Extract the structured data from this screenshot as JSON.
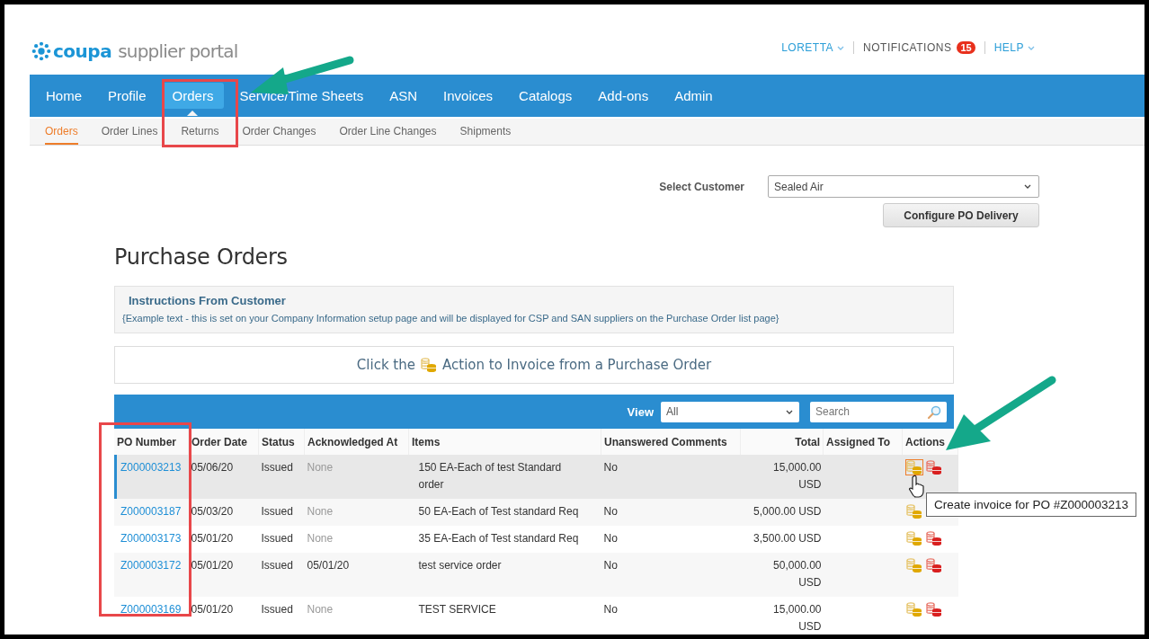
{
  "header": {
    "logo": {
      "brand": "coupa",
      "product": "supplier portal"
    },
    "user_menu": "LORETTA",
    "notifications": {
      "label": "NOTIFICATIONS",
      "count": "15"
    },
    "help": "HELP"
  },
  "nav": [
    {
      "label": "Home",
      "selected": false
    },
    {
      "label": "Profile",
      "selected": false
    },
    {
      "label": "Orders",
      "selected": true
    },
    {
      "label": "Service/Time Sheets",
      "selected": false
    },
    {
      "label": "ASN",
      "selected": false
    },
    {
      "label": "Invoices",
      "selected": false
    },
    {
      "label": "Catalogs",
      "selected": false
    },
    {
      "label": "Add-ons",
      "selected": false
    },
    {
      "label": "Admin",
      "selected": false
    }
  ],
  "subnav": [
    {
      "label": "Orders",
      "selected": true
    },
    {
      "label": "Order Lines",
      "selected": false
    },
    {
      "label": "Returns",
      "selected": false
    },
    {
      "label": "Order Changes",
      "selected": false
    },
    {
      "label": "Order Line Changes",
      "selected": false
    },
    {
      "label": "Shipments",
      "selected": false
    }
  ],
  "customer": {
    "label": "Select Customer",
    "value": "Sealed Air"
  },
  "configure_button": "Configure PO Delivery",
  "page_title": "Purchase Orders",
  "instructions": {
    "title": "Instructions From Customer",
    "text": "{Example text - this is set on your Company Information setup page and will be displayed for CSP and SAN suppliers on the Purchase Order list page}"
  },
  "invoice_hint": {
    "before": "Click the",
    "after": "Action to Invoice from a Purchase Order"
  },
  "table": {
    "view_label": "View",
    "view_value": "All",
    "search_placeholder": "Search",
    "columns": [
      "PO Number",
      "Order Date",
      "Status",
      "Acknowledged At",
      "Items",
      "Unanswered Comments",
      "Total",
      "Assigned To",
      "Actions"
    ],
    "rows": [
      {
        "po_number": "Z000003213",
        "order_date": "05/06/20",
        "status": "Issued",
        "acknowledged_at": "None",
        "acknowledged": false,
        "items": "150 EA-Each of test Standard order",
        "unanswered_comments": "No",
        "total": "15,000.00 USD",
        "selected": true,
        "actions": [
          {
            "kind": "invoice",
            "focused": true
          },
          {
            "kind": "flip",
            "focused": false
          }
        ]
      },
      {
        "po_number": "Z000003187",
        "order_date": "05/03/20",
        "status": "Issued",
        "acknowledged_at": "None",
        "acknowledged": false,
        "items": "50 EA-Each of Test standard Req",
        "unanswered_comments": "No",
        "total": "5,000.00 USD",
        "selected": false,
        "actions": [
          {
            "kind": "invoice",
            "focused": false
          }
        ]
      },
      {
        "po_number": "Z000003173",
        "order_date": "05/01/20",
        "status": "Issued",
        "acknowledged_at": "None",
        "acknowledged": false,
        "items": "35 EA-Each of Test standard Req",
        "unanswered_comments": "No",
        "total": "3,500.00 USD",
        "selected": false,
        "actions": [
          {
            "kind": "invoice",
            "focused": false
          },
          {
            "kind": "flip",
            "focused": false
          }
        ]
      },
      {
        "po_number": "Z000003172",
        "order_date": "05/01/20",
        "status": "Issued",
        "acknowledged_at": "05/01/20",
        "acknowledged": true,
        "items": "test service order",
        "unanswered_comments": "No",
        "total": "50,000.00 USD",
        "selected": false,
        "actions": [
          {
            "kind": "invoice",
            "focused": false
          },
          {
            "kind": "flip",
            "focused": false
          }
        ]
      },
      {
        "po_number": "Z000003169",
        "order_date": "05/01/20",
        "status": "Issued",
        "acknowledged_at": "None",
        "acknowledged": false,
        "items": "TEST SERVICE",
        "unanswered_comments": "No",
        "total": "15,000.00 USD",
        "selected": false,
        "actions": [
          {
            "kind": "invoice",
            "focused": false
          },
          {
            "kind": "flip",
            "focused": false
          }
        ]
      }
    ]
  },
  "tooltip": "Create invoice for PO #Z000003213"
}
